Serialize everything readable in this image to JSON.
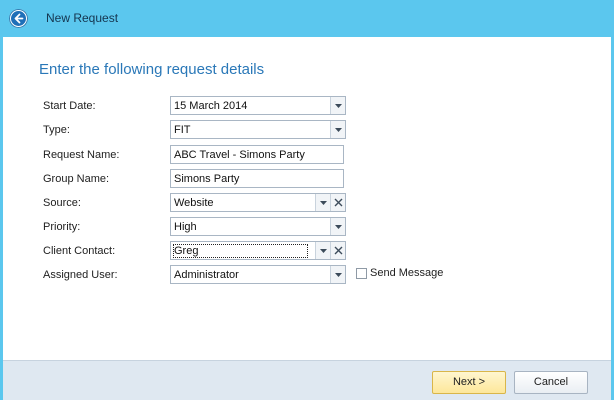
{
  "window": {
    "title": "New Request"
  },
  "heading": "Enter the following request details",
  "fields": {
    "start_date": {
      "label": "Start Date:",
      "value": "15 March 2014"
    },
    "type": {
      "label": "Type:",
      "value": "FIT"
    },
    "request_name": {
      "label": "Request Name:",
      "value": "ABC Travel - Simons Party"
    },
    "group_name": {
      "label": "Group Name:",
      "value": "Simons Party"
    },
    "source": {
      "label": "Source:",
      "value": "Website"
    },
    "priority": {
      "label": "Priority:",
      "value": "High"
    },
    "client_contact": {
      "label": "Client Contact:",
      "value": "Greg"
    },
    "assigned_user": {
      "label": "Assigned User:",
      "value": "Administrator"
    }
  },
  "send_message": {
    "label": "Send Message",
    "checked": false
  },
  "buttons": {
    "next": "Next >",
    "cancel": "Cancel"
  },
  "colors": {
    "titlebar": "#5bc7ee",
    "heading": "#2a78b8",
    "footer": "#dfe8f1",
    "primary_button": "#fde79a"
  }
}
